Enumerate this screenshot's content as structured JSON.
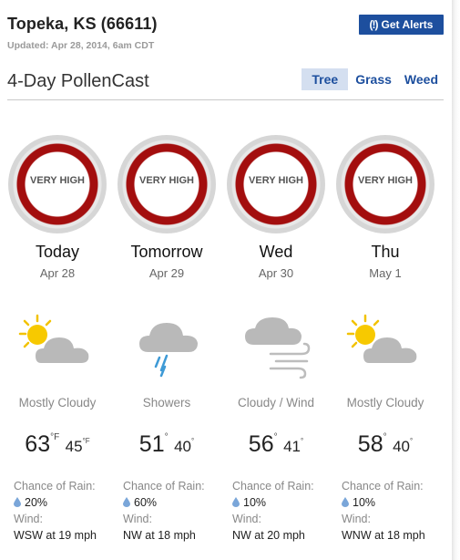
{
  "header": {
    "location": "Topeka, KS (66611)",
    "updated": "Updated: Apr 28, 2014, 6am CDT"
  },
  "alerts_button": {
    "icon": "alert-icon",
    "label": "Get Alerts"
  },
  "section": {
    "title": "4-Day PollenCast",
    "tabs": [
      {
        "label": "Tree",
        "active": true
      },
      {
        "label": "Grass",
        "active": false
      },
      {
        "label": "Weed",
        "active": false
      }
    ]
  },
  "labels": {
    "chance_of_rain": "Chance of Rain:",
    "wind": "Wind:"
  },
  "colors": {
    "ring": "#a30e0e",
    "accent": "#1d4f9e",
    "tab_active_bg": "#d4dff0"
  },
  "days": [
    {
      "name": "Today",
      "date": "Apr 28",
      "pollen_level": "VERY HIGH",
      "icon": "mostly-cloudy-icon",
      "condition": "Mostly Cloudy",
      "high": "63",
      "high_unit": "°F",
      "low": "45",
      "low_unit": "°F",
      "rain": "20%",
      "wind": "WSW at 19 mph"
    },
    {
      "name": "Tomorrow",
      "date": "Apr 29",
      "pollen_level": "VERY HIGH",
      "icon": "showers-icon",
      "condition": "Showers",
      "high": "51",
      "high_unit": "°",
      "low": "40",
      "low_unit": "°",
      "rain": "60%",
      "wind": "NW at 18 mph"
    },
    {
      "name": "Wed",
      "date": "Apr 30",
      "pollen_level": "VERY HIGH",
      "icon": "cloudy-wind-icon",
      "condition": "Cloudy / Wind",
      "high": "56",
      "high_unit": "°",
      "low": "41",
      "low_unit": "°",
      "rain": "10%",
      "wind": "NW at 20 mph"
    },
    {
      "name": "Thu",
      "date": "May 1",
      "pollen_level": "VERY HIGH",
      "icon": "mostly-cloudy-icon",
      "condition": "Mostly Cloudy",
      "high": "58",
      "high_unit": "°",
      "low": "40",
      "low_unit": "°",
      "rain": "10%",
      "wind": "WNW at 18 mph"
    }
  ]
}
